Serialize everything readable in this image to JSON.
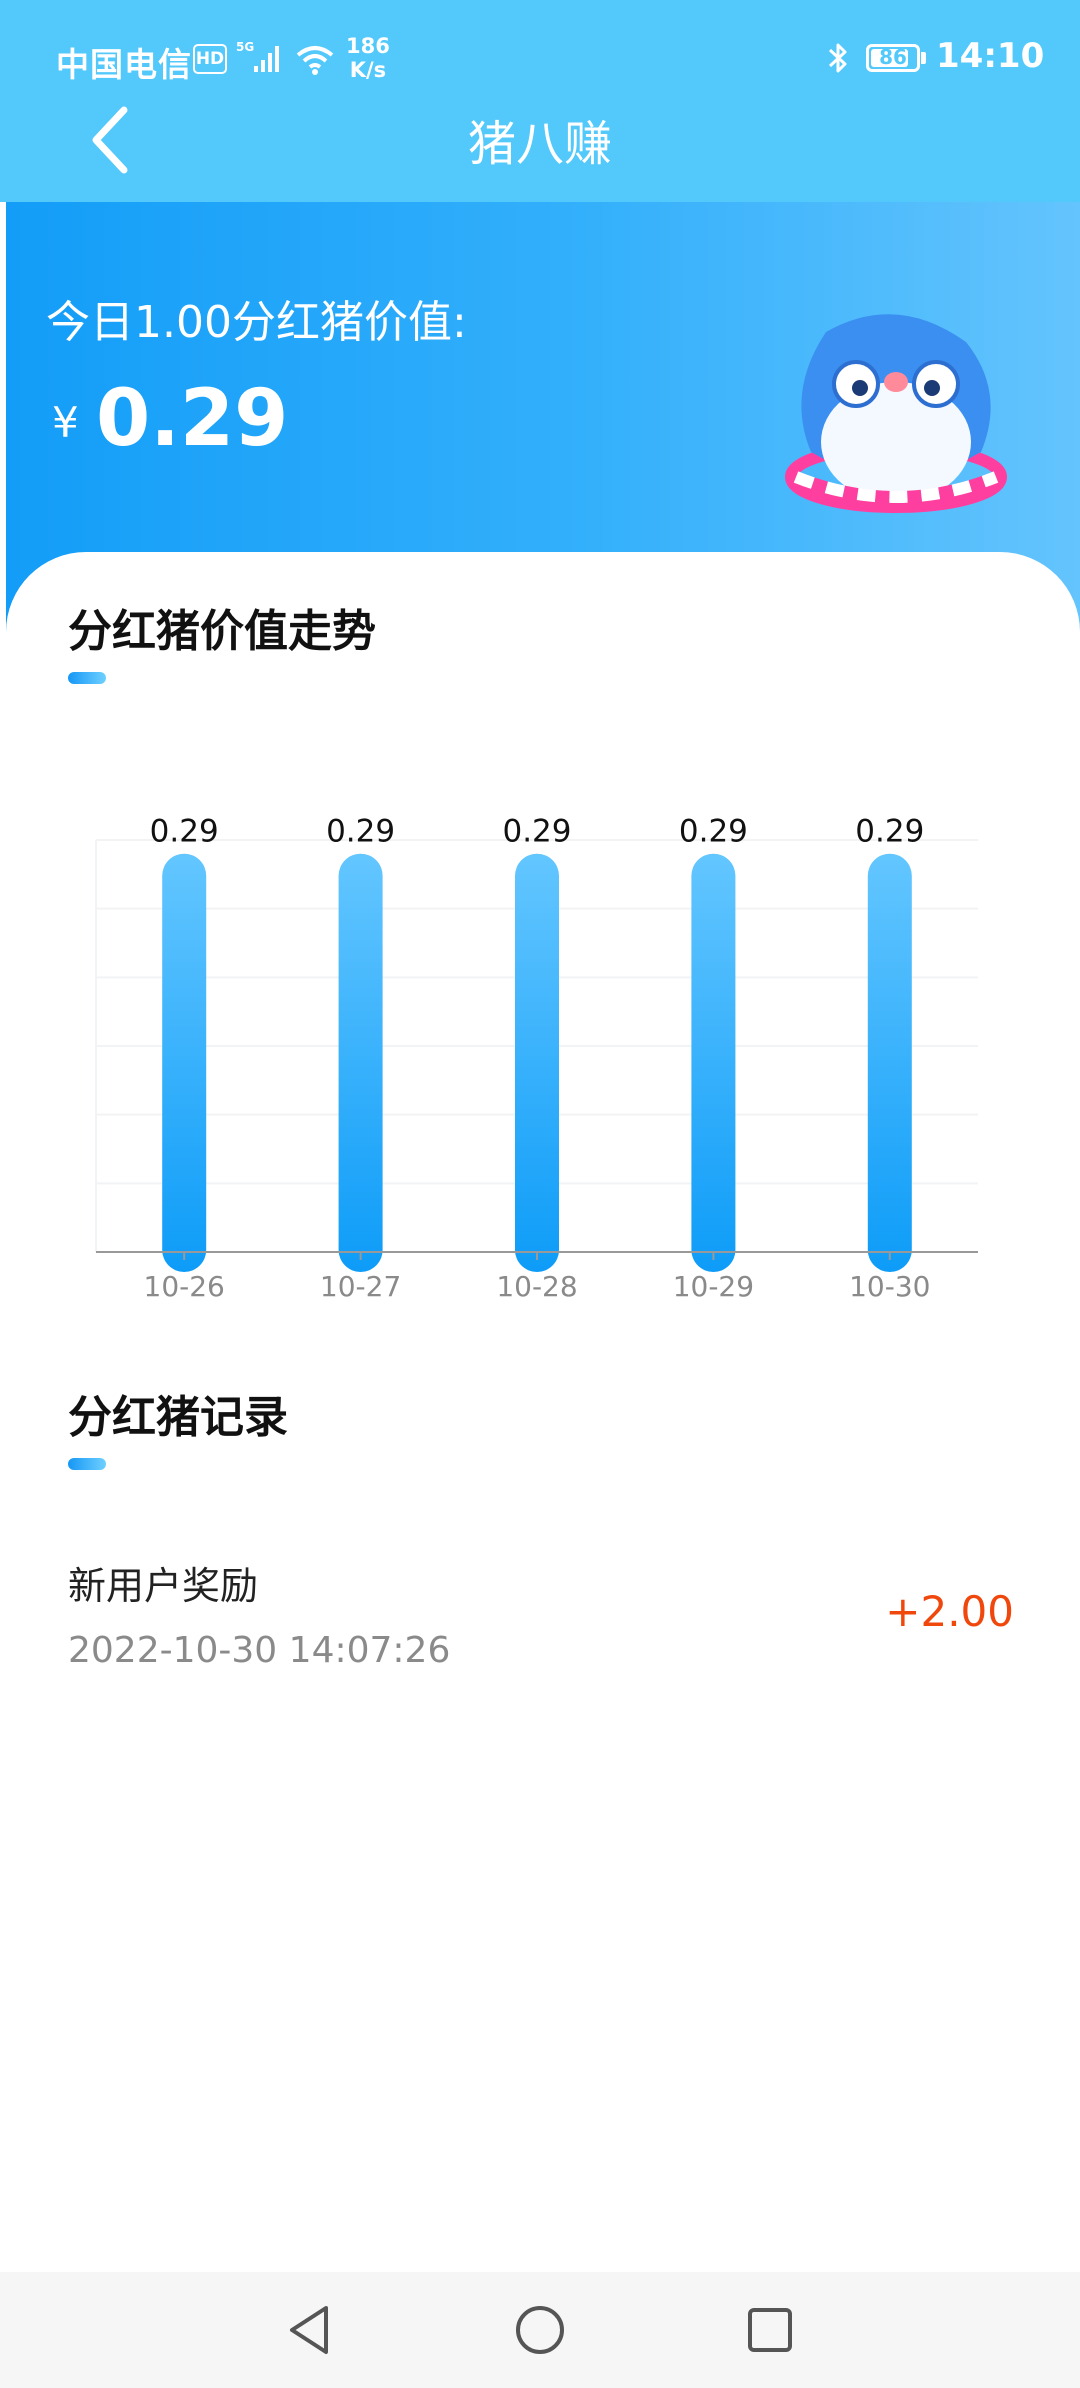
{
  "status_bar": {
    "carrier": "中国电信",
    "hd": "HD",
    "network": "5G",
    "speed_value": "186",
    "speed_unit": "K/s",
    "battery": "86",
    "battery_level": 0.86,
    "time": "14:10"
  },
  "nav": {
    "title": "猪八赚",
    "back_icon": "chevron-left-icon"
  },
  "banner": {
    "label": "今日1.00分红猪价值:",
    "currency": "¥",
    "value": "0.29",
    "mascot": "bird-mascot-with-hula-hoop"
  },
  "trend": {
    "title": "分红猪价值走势",
    "chart_data": {
      "type": "bar",
      "categories": [
        "10-26",
        "10-27",
        "10-28",
        "10-29",
        "10-30"
      ],
      "values": [
        0.29,
        0.29,
        0.29,
        0.29,
        0.29
      ],
      "data_labels": [
        "0.29",
        "0.29",
        "0.29",
        "0.29",
        "0.29"
      ],
      "ylim": [
        0,
        0.3
      ],
      "grid": true,
      "bar_gradient": [
        "#63c6ff",
        "#0d9cf8"
      ]
    }
  },
  "records": {
    "title": "分红猪记录",
    "items": [
      {
        "title": "新用户奖励",
        "time": "2022-10-30 14:07:26",
        "amount": "+2.00"
      }
    ]
  },
  "bottom_nav": {
    "back": "triangle-back-icon",
    "home": "circle-home-icon",
    "recent": "square-recent-icon"
  },
  "colors": {
    "header": "#52c8fb",
    "accent": "#139df8",
    "amount": "#f0470d"
  }
}
